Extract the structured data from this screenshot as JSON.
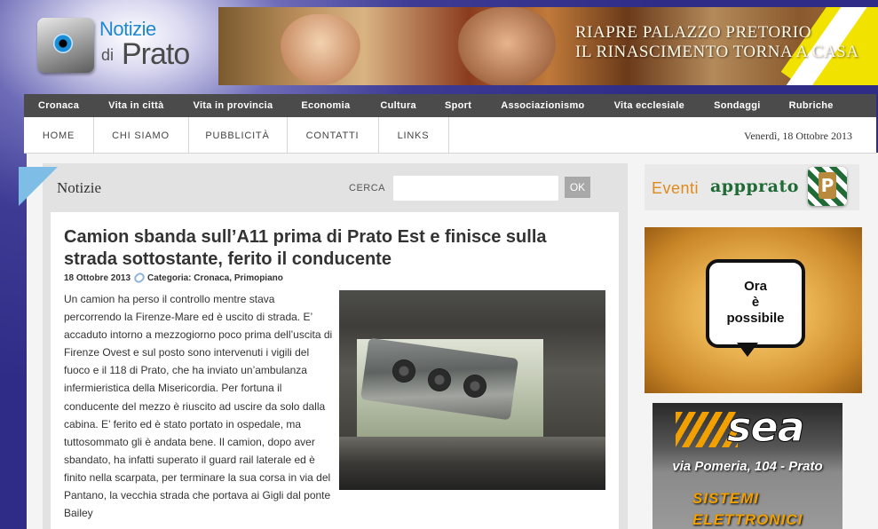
{
  "header": {
    "logo": {
      "line1": "Notizie",
      "line2_prefix": "di",
      "line2": "Prato"
    },
    "banner": {
      "line1": "RIAPRE PALAZZO PRETORIO",
      "line2": "IL RINASCIMENTO TORNA A CASA"
    }
  },
  "category_nav": [
    "Cronaca",
    "Vita in città",
    "Vita in provincia",
    "Economia",
    "Cultura",
    "Sport",
    "Associazionismo",
    "Vita ecclesiale",
    "Sondaggi",
    "Rubriche"
  ],
  "sub_nav": [
    "HOME",
    "CHI SIAMO",
    "PUBBLICITÀ",
    "CONTATTI",
    "LINKS"
  ],
  "date": "Venerdì, 18 Ottobre 2013",
  "section": {
    "title": "Notizie",
    "search_label": "CERCA",
    "search_value": "",
    "search_button": "OK"
  },
  "article": {
    "title": "Camion sbanda sull’A11 prima di Prato Est e finisce sulla strada sottostante, ferito il conducente",
    "date": "18 Ottobre 2013",
    "category_label": "Categoria:",
    "categories": "Cronaca, Primopiano",
    "body": "Un camion ha perso il controllo mentre stava percorrendo la Firenze-Mare ed è uscito di strada. E’ accaduto intorno a mezzogiorno poco prima dell’uscita di Firenze Ovest e sul posto sono intervenuti i vigili del fuoco e il 118 di Prato, che ha inviato un’ambulanza infermieristica della Misericordia. Per fortuna il conducente del mezzo è riuscito ad uscire da solo dalla cabina. E’ ferito ed è stato portato in ospedale, ma tuttosommato gli è andata bene. Il camion, dopo aver sbandato, ha infatti superato il guard rail laterale ed è finito nella scarpata, per terminare la sua corsa in via del Pantano, la vecchia strada che portava ai Gigli dal ponte Bailey"
  },
  "sidebar": {
    "eventi": {
      "label": "Eventi",
      "brand": "appprato",
      "logo_letter": "P"
    },
    "ad1": {
      "line1": "Ora",
      "line2": "è",
      "line3": "possibile"
    },
    "ad2": {
      "logo": "sea",
      "address": "via Pomeria, 104 - Prato",
      "line1": "SISTEMI",
      "line2": "ELETTRONICI"
    }
  }
}
